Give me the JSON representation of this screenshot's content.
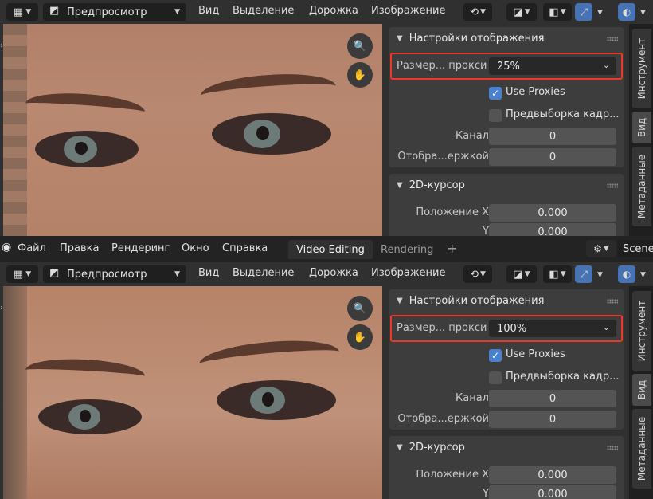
{
  "colors": {
    "accent": "#4772b3",
    "highlight": "#e8392b",
    "panel": "#3d3d3d",
    "bg": "#303030"
  },
  "topbar": {
    "menus": [
      "Файл",
      "Правка",
      "Рендеринг",
      "Окно",
      "Справка"
    ],
    "tabs": [
      "Video Editing",
      "Rendering"
    ],
    "add_tab": "+",
    "scene_label": "Scene"
  },
  "header": {
    "mode": "Предпросмотр",
    "menus": [
      "Вид",
      "Выделение",
      "Дорожка",
      "Изображение"
    ]
  },
  "sidebar": {
    "tabs": [
      "Инструмент",
      "Вид",
      "Метаданные"
    ],
    "display_panel": {
      "title": "Настройки отображения",
      "proxy_label": "Размер... прокси",
      "use_proxies_label": "Use Proxies",
      "use_proxies_checked": true,
      "prefetch_label": "Предвыборка кадр...",
      "prefetch_checked": false,
      "channel_label": "Канал",
      "channel_value": "0",
      "display_label": "Отобра...ержкой",
      "display_value": "0"
    },
    "cursor_panel": {
      "title": "2D-курсор",
      "pos_x_label": "Положение X",
      "pos_x_value": "0.000",
      "pos_y_label": "Y",
      "pos_y_value": "0.000"
    }
  },
  "panes": {
    "top": {
      "proxy_size": "25%"
    },
    "bottom": {
      "proxy_size": "100%"
    }
  }
}
